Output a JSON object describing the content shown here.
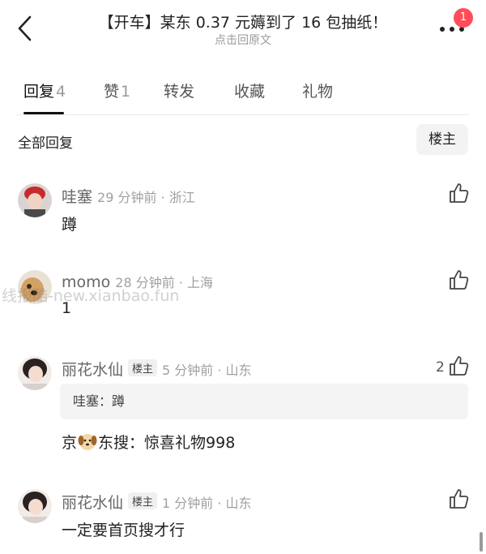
{
  "header": {
    "title": "【开车】某东 0.37 元薅到了 16 包抽纸！",
    "subtitle": "点击回原文",
    "notification_count": "1"
  },
  "tabs": [
    {
      "label": "回复",
      "count": "4"
    },
    {
      "label": "赞",
      "count": "1"
    },
    {
      "label": "转发",
      "count": ""
    },
    {
      "label": "收藏",
      "count": ""
    },
    {
      "label": "礼物",
      "count": ""
    }
  ],
  "filter": {
    "all_replies": "全部回复",
    "owner_only": "楼主"
  },
  "watermark": "线报酷-new.xianbao.fun",
  "comments": [
    {
      "name": "哇塞",
      "time": "29 分钟前 · 浙江",
      "text": "蹲",
      "likes": ""
    },
    {
      "name": "momo",
      "time": "28 分钟前 · 上海",
      "text": "1",
      "likes": ""
    },
    {
      "name": "丽花水仙",
      "tag": "楼主",
      "time": "5 分钟前 · 山东",
      "quote": "哇塞：蹲",
      "text_before": "京",
      "text_after": "东搜：惊喜礼物998",
      "likes": "2"
    },
    {
      "name": "丽花水仙",
      "tag": "楼主",
      "time": "1 分钟前 · 山东",
      "text": "一定要首页搜才行",
      "likes": ""
    }
  ],
  "colors": {
    "badge": "#ff4d5a",
    "muted": "#9a9a9a",
    "quote_bg": "#f4f4f4"
  }
}
